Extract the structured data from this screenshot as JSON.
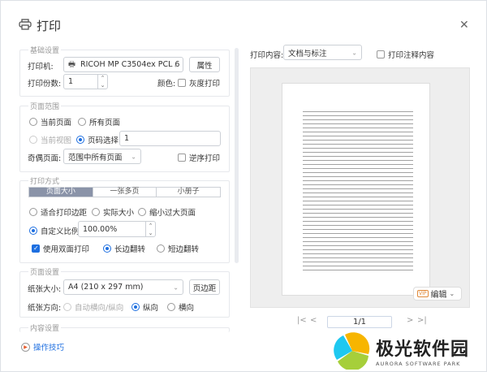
{
  "window": {
    "title": "打印",
    "close": "✕"
  },
  "basic": {
    "legend": "基础设置",
    "printer_label": "打印机:",
    "printer_value": "RICOH MP C3504ex PCL 6",
    "properties_button": "属性",
    "copies_label": "打印份数:",
    "copies_value": "1",
    "color_label": "颜色:",
    "grayscale_label": "灰度打印",
    "grayscale_checked": false
  },
  "range": {
    "legend": "页面范围",
    "current_page": "当前页面",
    "all_pages": "所有页面",
    "current_view": "当前视图",
    "page_select": "页码选择:",
    "page_select_value": "1",
    "selected": "page_select",
    "odd_even_label": "奇偶页面:",
    "odd_even_value": "范围中所有页面",
    "reverse_label": "逆序打印",
    "reverse_checked": false
  },
  "mode": {
    "legend": "打印方式",
    "tabs": [
      "页面大小",
      "一张多页",
      "小册子"
    ],
    "active_tab": 0,
    "fit_margin": "适合打印边距",
    "actual_size": "实际大小",
    "shrink_large": "缩小过大页面",
    "custom_scale": "自定义比例",
    "scale_value": "100.00%",
    "duplex_label": "使用双面打印",
    "duplex_checked": true,
    "long_edge": "长边翻转",
    "short_edge": "短边翻转",
    "flip": "long_edge"
  },
  "pagesetup": {
    "legend": "页面设置",
    "paper_size_label": "纸张大小:",
    "paper_size_value": "A4 (210 x 297 mm)",
    "margins_button": "页边距",
    "orientation_label": "纸张方向:",
    "auto": "自动横向/纵向",
    "portrait": "纵向",
    "landscape": "横向",
    "orientation": "portrait"
  },
  "content_settings": {
    "legend": "内容设置"
  },
  "tips": {
    "label": "操作技巧"
  },
  "right": {
    "content_label": "打印内容:",
    "content_value": "文档与标注",
    "annot_label": "打印注释内容",
    "annot_checked": false,
    "vip": "VIP",
    "edit_label": "编辑",
    "page_indicator": "1/1"
  },
  "logo": {
    "name": "极光软件园",
    "sub": "AURORA SOFTWARE PARK"
  },
  "colors": {
    "accent": "#1e6fe0",
    "segment_active": "#8a93a8"
  }
}
